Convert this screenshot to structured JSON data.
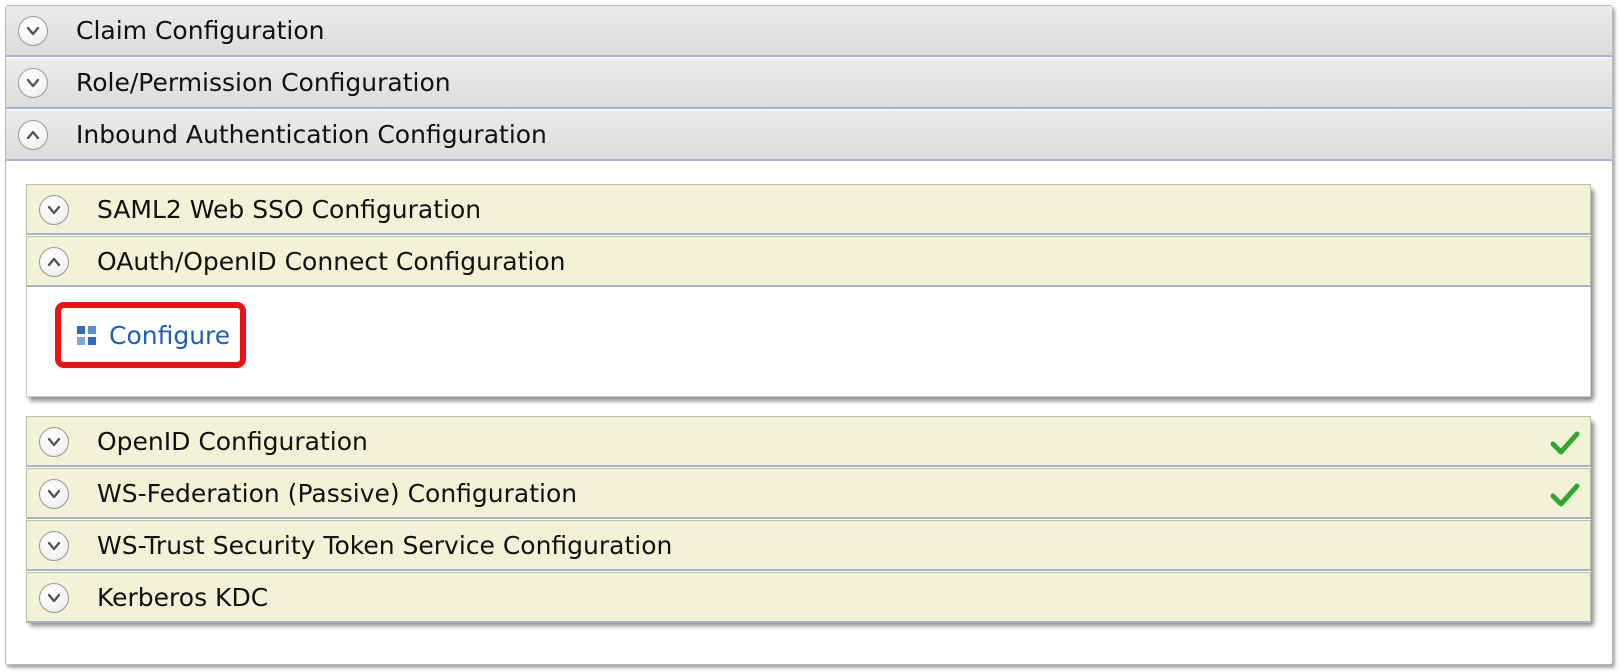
{
  "sections": {
    "claim": {
      "title": "Claim Configuration",
      "state": "collapsed"
    },
    "role": {
      "title": "Role/Permission Configuration",
      "state": "collapsed"
    },
    "inbound": {
      "title": "Inbound Authentication Configuration",
      "state": "expanded"
    }
  },
  "inbound_items": {
    "saml": {
      "title": "SAML2 Web SSO Configuration",
      "state": "collapsed"
    },
    "oauth": {
      "title": "OAuth/OpenID Connect Configuration",
      "state": "expanded",
      "action_label": "Configure"
    },
    "openid": {
      "title": "OpenID Configuration",
      "state": "collapsed",
      "configured": true
    },
    "wsfed": {
      "title": "WS-Federation (Passive) Configuration",
      "state": "collapsed",
      "configured": true
    },
    "wstrust": {
      "title": "WS-Trust Security Token Service Configuration",
      "state": "collapsed"
    },
    "kerberos": {
      "title": "Kerberos KDC",
      "state": "collapsed"
    }
  },
  "icons": {
    "collapsed": "chevron-down-icon",
    "expanded": "chevron-up-icon",
    "configured": "checkmark-icon",
    "configure": "grid-icon"
  },
  "colors": {
    "highlight_border": "#ee1111",
    "link": "#1f5fb8",
    "check": "#2fa82f",
    "inner_header_bg": "#f2f2d6",
    "top_header_bg": "#e4e4e4"
  }
}
